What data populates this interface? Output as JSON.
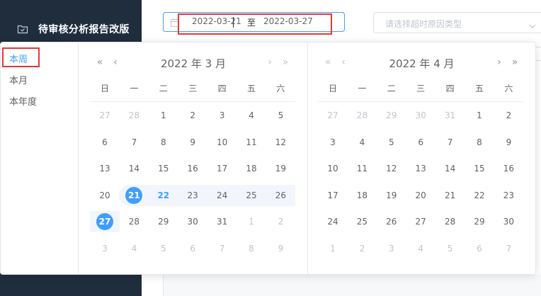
{
  "sidebar": {
    "menu_item_label": "待审核分析报告改版",
    "menu_icon": "folder-icon"
  },
  "filters": {
    "date_range": {
      "start": "2022-03-21",
      "separator": "至",
      "end": "2022-03-27"
    },
    "reason_select": {
      "placeholder": "请选择超时原因类型"
    }
  },
  "picker": {
    "shortcuts": [
      "本周",
      "本月",
      "本年度"
    ],
    "active_shortcut": "本周",
    "weekdays": [
      "日",
      "一",
      "二",
      "三",
      "四",
      "五",
      "六"
    ],
    "nav": {
      "prev_year": "«",
      "prev_month": "‹",
      "next_month": "›",
      "next_year": "»"
    },
    "left": {
      "title": "2022 年 3 月",
      "weeks": [
        [
          "27",
          "28",
          "1",
          "2",
          "3",
          "4",
          "5"
        ],
        [
          "6",
          "7",
          "8",
          "9",
          "10",
          "11",
          "12"
        ],
        [
          "13",
          "14",
          "15",
          "16",
          "17",
          "18",
          "19"
        ],
        [
          "20",
          "21",
          "22",
          "23",
          "24",
          "25",
          "26"
        ],
        [
          "27",
          "28",
          "29",
          "30",
          "31",
          "1",
          "2"
        ],
        [
          "3",
          "4",
          "5",
          "6",
          "7",
          "8",
          "9"
        ]
      ]
    },
    "right": {
      "title": "2022 年 4 月",
      "weeks": [
        [
          "27",
          "28",
          "29",
          "30",
          "31",
          "1",
          "2"
        ],
        [
          "3",
          "4",
          "5",
          "6",
          "7",
          "8",
          "9"
        ],
        [
          "10",
          "11",
          "12",
          "13",
          "14",
          "15",
          "16"
        ],
        [
          "17",
          "18",
          "19",
          "20",
          "21",
          "22",
          "23"
        ],
        [
          "24",
          "25",
          "26",
          "27",
          "28",
          "29",
          "30"
        ],
        [
          "1",
          "2",
          "3",
          "4",
          "5",
          "6",
          "7"
        ]
      ]
    }
  },
  "colors": {
    "accent": "#409eff",
    "sidebar_bg": "#1f2d3d",
    "highlight_red": "#e53935",
    "range_bg": "#f2f6fc"
  }
}
